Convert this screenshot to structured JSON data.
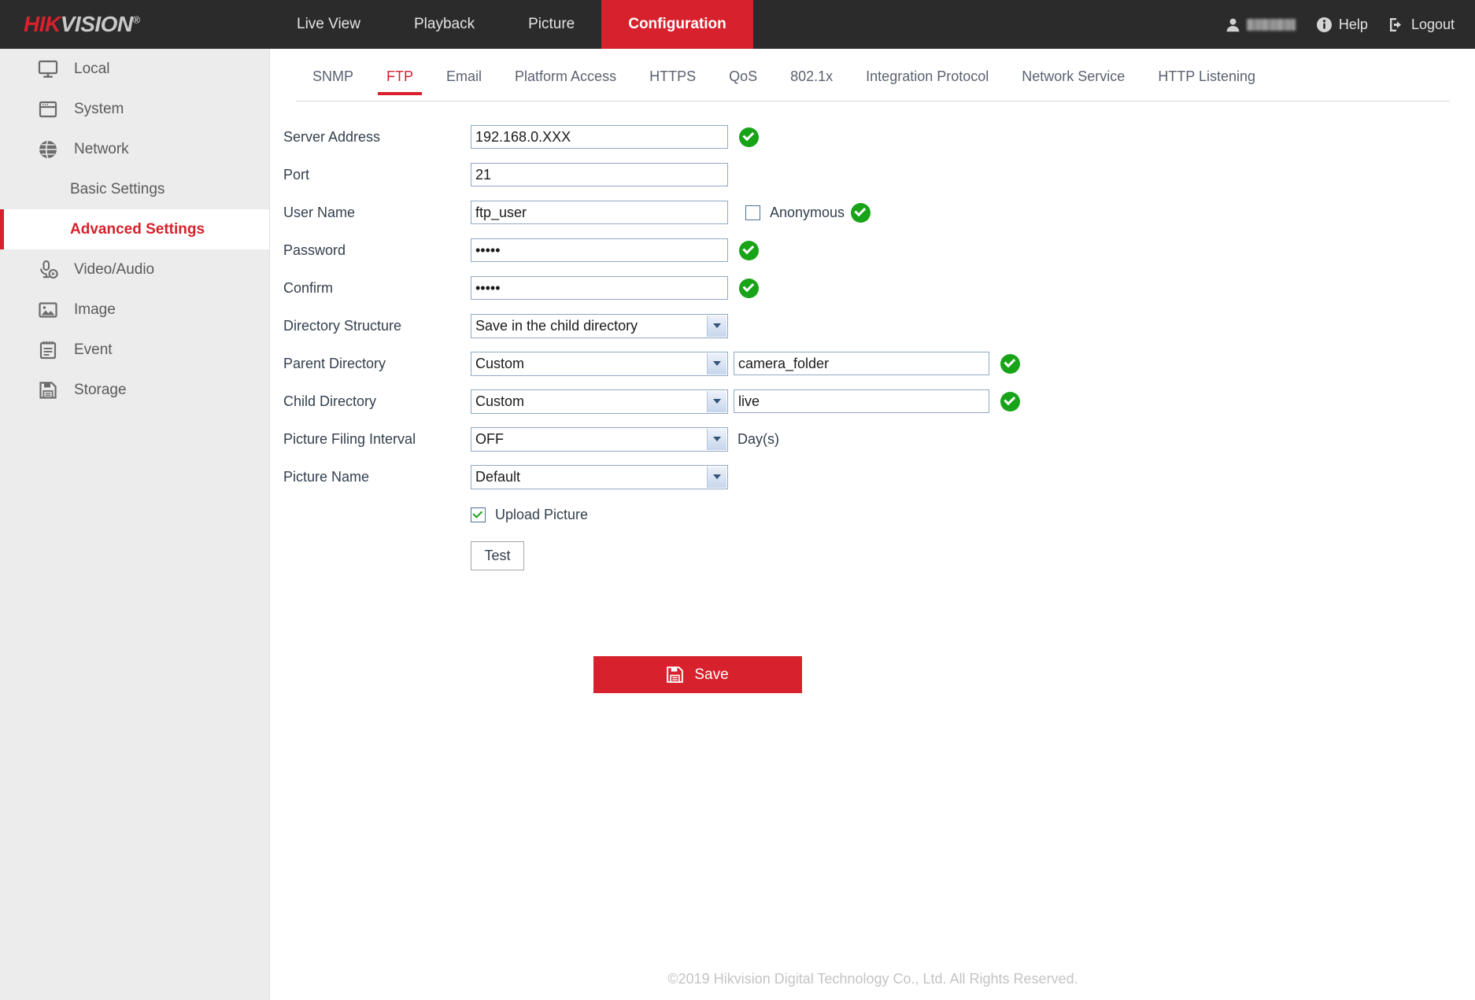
{
  "header": {
    "logo_hik": "HIK",
    "logo_vision": "VISION",
    "logo_reg": "®",
    "nav": [
      {
        "label": "Live View",
        "active": false
      },
      {
        "label": "Playback",
        "active": false
      },
      {
        "label": "Picture",
        "active": false
      },
      {
        "label": "Configuration",
        "active": true
      }
    ],
    "user_icon": "user-icon",
    "user_name": "",
    "help_icon": "info-icon",
    "help_label": "Help",
    "logout_icon": "logout-icon",
    "logout_label": "Logout"
  },
  "sidebar": {
    "items": [
      {
        "label": "Local",
        "icon": "monitor-icon",
        "type": "top"
      },
      {
        "label": "System",
        "icon": "window-icon",
        "type": "top"
      },
      {
        "label": "Network",
        "icon": "globe-icon",
        "type": "top"
      },
      {
        "label": "Basic Settings",
        "icon": "",
        "type": "sub",
        "active": false
      },
      {
        "label": "Advanced Settings",
        "icon": "",
        "type": "sub",
        "active": true
      },
      {
        "label": "Video/Audio",
        "icon": "mic-play-icon",
        "type": "top"
      },
      {
        "label": "Image",
        "icon": "picture-icon",
        "type": "top"
      },
      {
        "label": "Event",
        "icon": "notepad-icon",
        "type": "top"
      },
      {
        "label": "Storage",
        "icon": "floppy-icon",
        "type": "top"
      }
    ]
  },
  "tabs": [
    {
      "label": "SNMP",
      "active": false
    },
    {
      "label": "FTP",
      "active": true
    },
    {
      "label": "Email",
      "active": false
    },
    {
      "label": "Platform Access",
      "active": false
    },
    {
      "label": "HTTPS",
      "active": false
    },
    {
      "label": "QoS",
      "active": false
    },
    {
      "label": "802.1x",
      "active": false
    },
    {
      "label": "Integration Protocol",
      "active": false
    },
    {
      "label": "Network Service",
      "active": false
    },
    {
      "label": "HTTP Listening",
      "active": false
    }
  ],
  "form": {
    "server_address": {
      "label": "Server Address",
      "value": "192.168.0.XXX",
      "valid": true
    },
    "port": {
      "label": "Port",
      "value": "21",
      "valid": false
    },
    "user_name": {
      "label": "User Name",
      "value": "ftp_user",
      "anonymous_label": "Anonymous",
      "anonymous_checked": false,
      "valid": true
    },
    "password": {
      "label": "Password",
      "value": "•••••",
      "valid": true
    },
    "confirm": {
      "label": "Confirm",
      "value": "•••••",
      "valid": true
    },
    "directory_structure": {
      "label": "Directory Structure",
      "value": "Save in the child directory"
    },
    "parent_directory": {
      "label": "Parent Directory",
      "value": "Custom",
      "text_value": "camera_folder",
      "valid": true
    },
    "child_directory": {
      "label": "Child Directory",
      "value": "Custom",
      "text_value": "live",
      "valid": true
    },
    "picture_filing_interval": {
      "label": "Picture Filing Interval",
      "value": "OFF",
      "unit": "Day(s)"
    },
    "picture_name": {
      "label": "Picture Name",
      "value": "Default"
    },
    "upload_picture": {
      "label": "Upload Picture",
      "checked": true
    },
    "test_button": "Test",
    "save_button": "Save"
  },
  "footer": {
    "copyright": "©2019 Hikvision Digital Technology Co., Ltd. All Rights Reserved."
  },
  "colors": {
    "brand_red": "#d7212d",
    "header_dark": "#2b2b2b",
    "sidebar_bg": "#ececec",
    "valid_green": "#18a318"
  }
}
